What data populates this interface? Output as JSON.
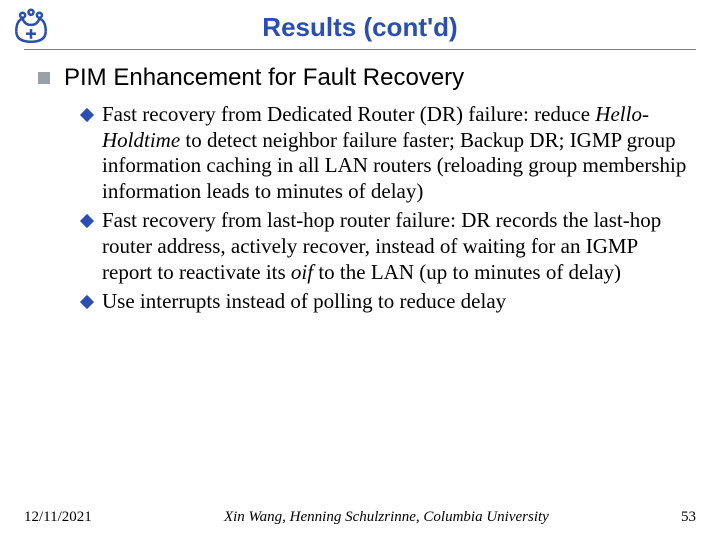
{
  "title": "Results (cont'd)",
  "heading": "PIM Enhancement for Fault Recovery",
  "bullets": {
    "b1_lead": "Fast recovery from Dedicated Router (DR) failure: reduce ",
    "b1_italic1": "Hello-Holdtime",
    "b1_tail": " to detect neighbor failure faster; Backup DR; IGMP group information caching in all LAN routers (reloading group membership information leads to minutes of delay)",
    "b2_lead": "Fast recovery from last-hop router failure: DR records the last-hop router address, actively recover, instead of waiting for an IGMP report to reactivate its ",
    "b2_italic1": "oif",
    "b2_tail": " to the LAN (up to minutes of delay)",
    "b3": "Use interrupts instead of polling to reduce delay"
  },
  "footer": {
    "date": "12/11/2021",
    "center": "Xin Wang, Henning Schulzrinne, Columbia University",
    "page": "53"
  }
}
